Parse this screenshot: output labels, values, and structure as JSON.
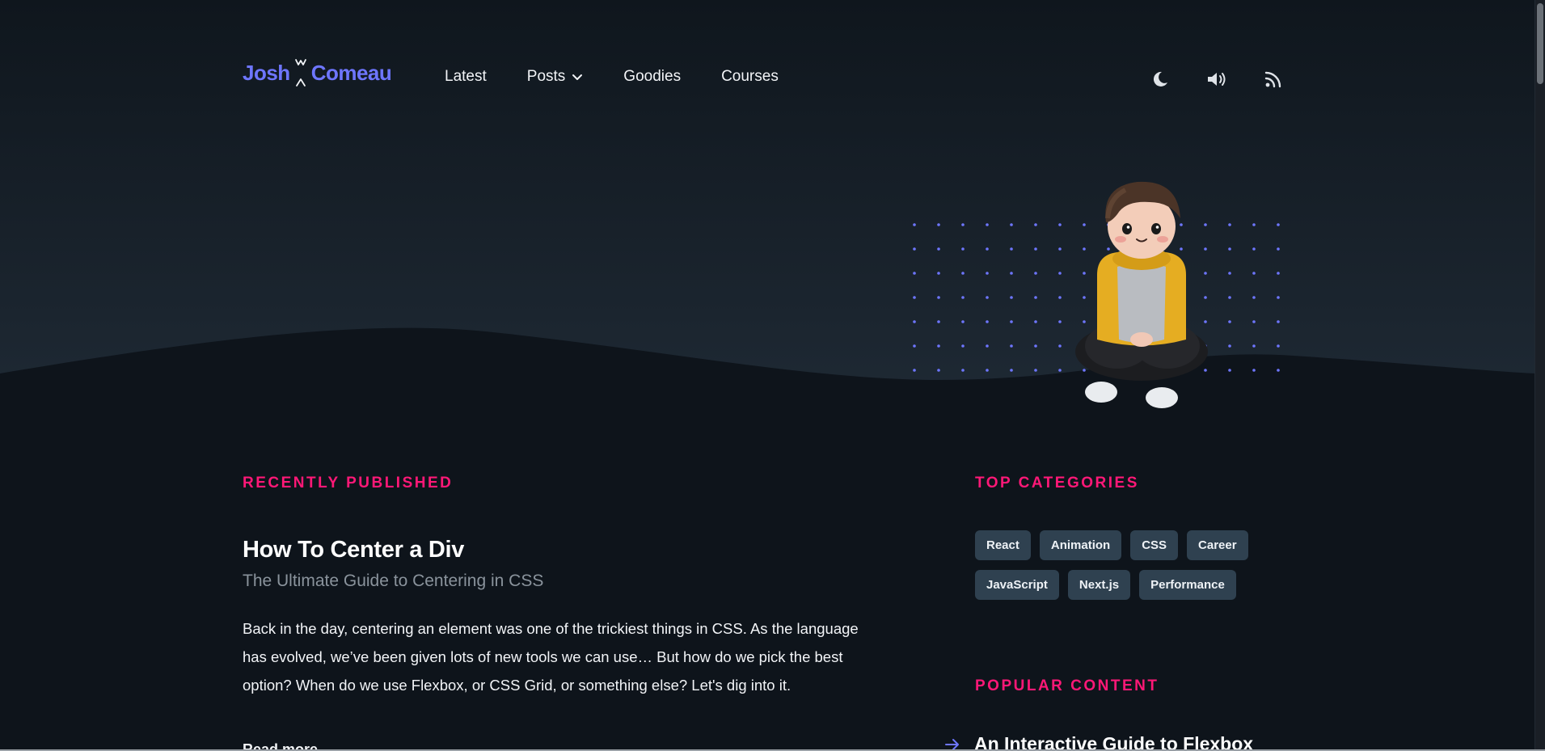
{
  "header": {
    "logo": {
      "first": "Josh",
      "second": "Comeau"
    },
    "nav": [
      {
        "label": "Latest"
      },
      {
        "label": "Posts",
        "has_dropdown": true
      },
      {
        "label": "Goodies"
      },
      {
        "label": "Courses"
      }
    ],
    "icons": [
      "moon-icon",
      "speaker-icon",
      "rss-icon"
    ]
  },
  "main": {
    "recent_label": "RECENTLY PUBLISHED",
    "post": {
      "title": "How To Center a Div",
      "subtitle": "The Ultimate Guide to Centering in CSS",
      "body": "Back in the day, centering an element was one of the trickiest things in CSS. As the language has evolved, we’ve been given lots of new tools we can use… But how do we pick the best option? When do we use Flexbox, or CSS Grid, or something else? Let's dig into it.",
      "read_more": "Read more"
    }
  },
  "sidebar": {
    "categories_label": "TOP CATEGORIES",
    "categories": [
      "React",
      "Animation",
      "CSS",
      "Career",
      "JavaScript",
      "Next.js",
      "Performance"
    ],
    "popular_label": "POPULAR CONTENT",
    "popular": [
      {
        "title": "An Interactive Guide to Flexbox"
      }
    ]
  },
  "colors": {
    "background": "#0e141b",
    "hero": "#1f2a34",
    "accent_pink": "#ff1877",
    "accent_blue": "#6e76ff",
    "tag_bg": "#2f4150"
  }
}
